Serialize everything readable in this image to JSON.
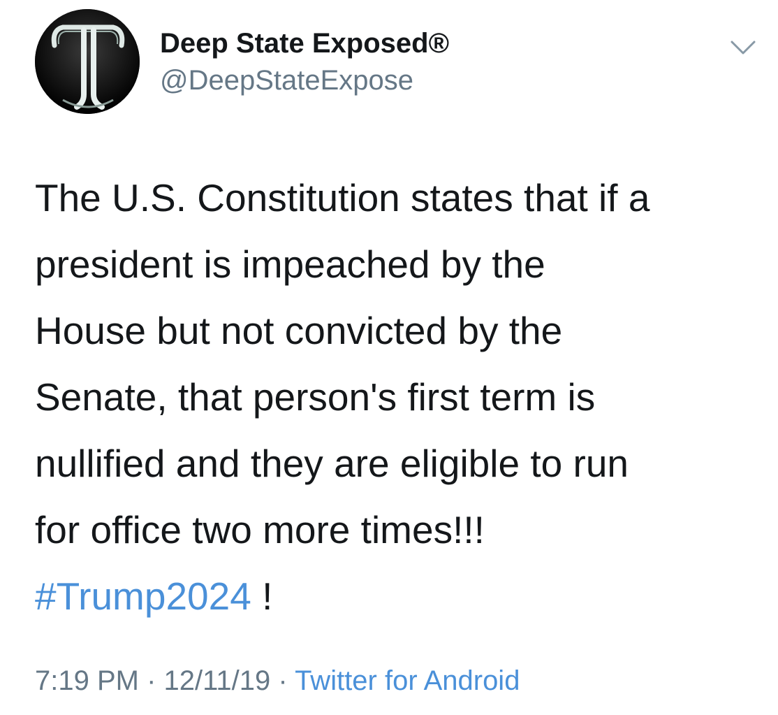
{
  "tweet": {
    "author": {
      "display_name": "Deep State Exposed®",
      "handle": "@DeepStateExpose",
      "avatar_icon": "neon-letter-t-avatar"
    },
    "menu_icon": "chevron-down-icon",
    "body_lines": [
      "The U.S. Constitution states that if a",
      "president is impeached by the",
      "House but not convicted by the",
      "Senate, that person's first term is",
      "nullified and they are eligible to run",
      "for office two more times!!!"
    ],
    "hashtag": "#Trump2024",
    "hashtag_suffix": " !",
    "time": "7:19 PM",
    "date": "12/11/19",
    "separator": " · ",
    "source": "Twitter for Android"
  },
  "colors": {
    "text": "#14171a",
    "secondary": "#657786",
    "link": "#4a90d9",
    "background": "#ffffff"
  }
}
